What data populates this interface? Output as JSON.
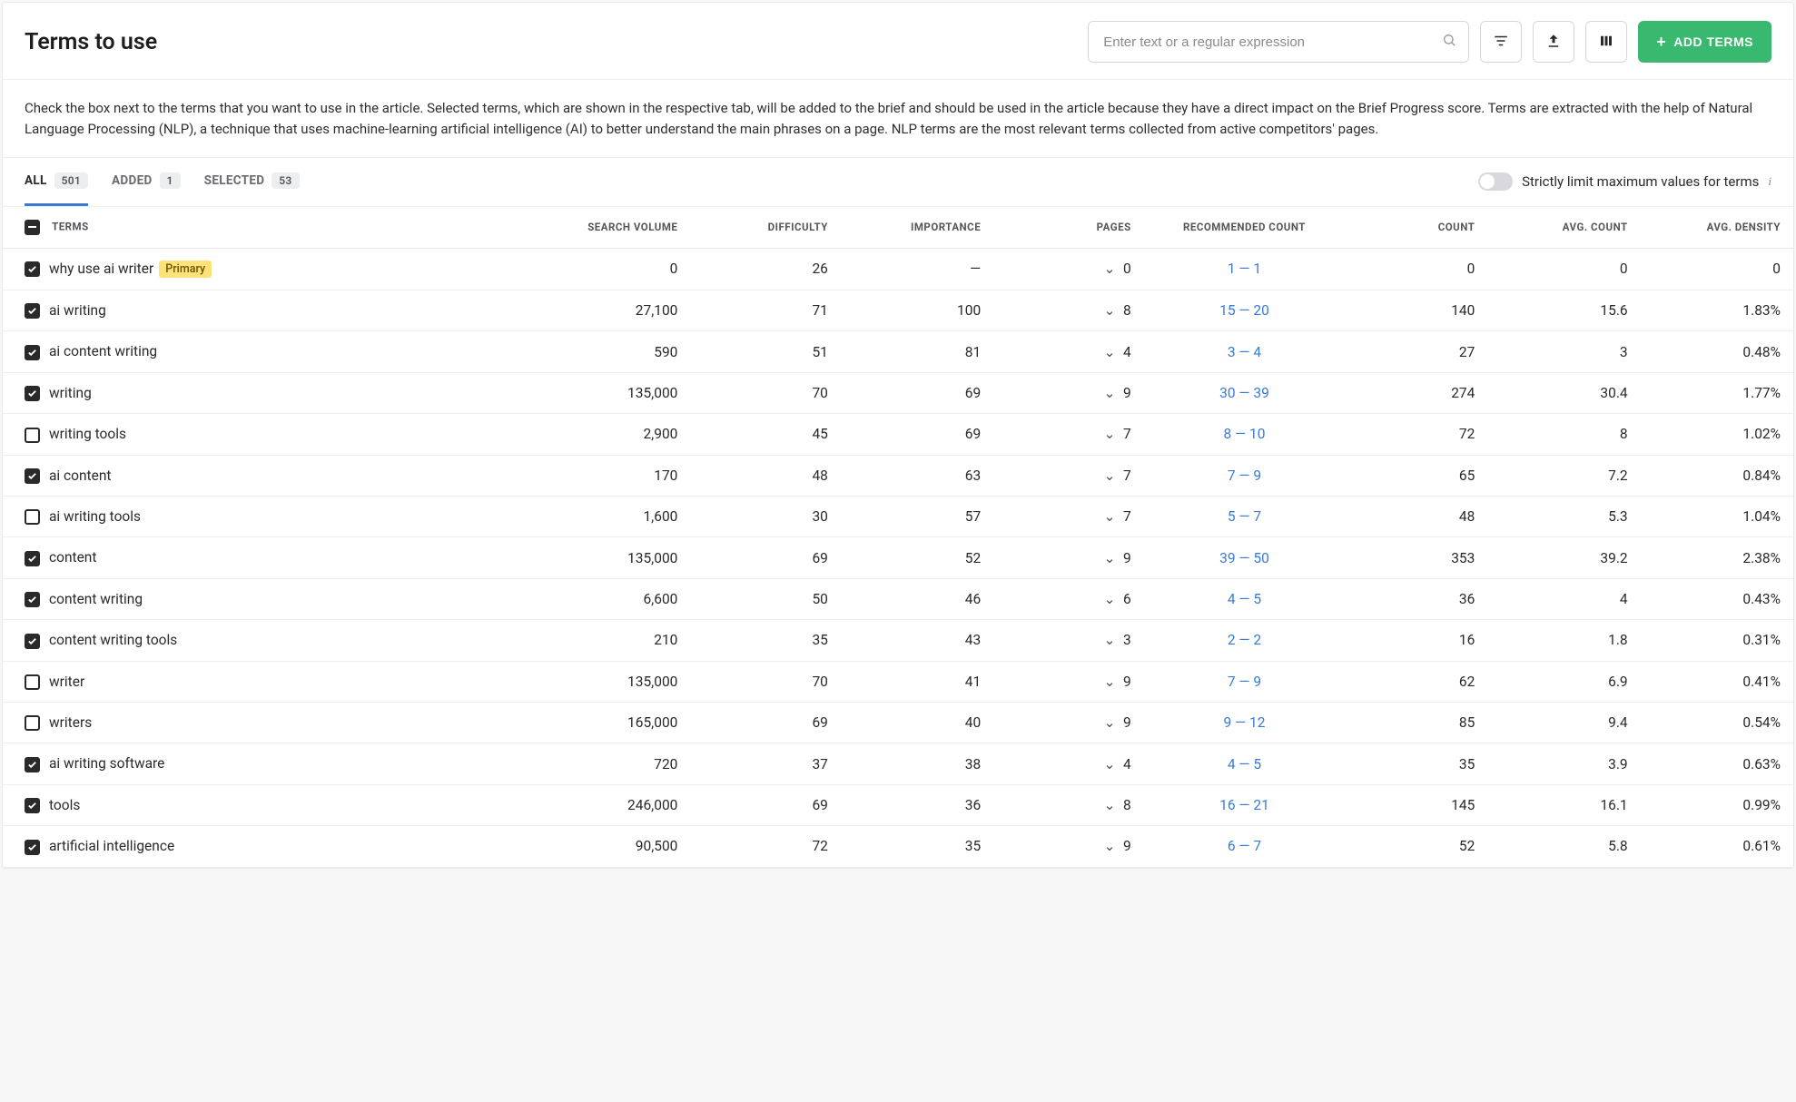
{
  "header": {
    "title": "Terms to use",
    "search_placeholder": "Enter text or a regular expression",
    "add_button": "ADD TERMS"
  },
  "description": "Check the box next to the terms that you want to use in the article. Selected terms, which are shown in the respective tab, will be added to the brief and should be used in the article because they have a direct impact on the Brief Progress score. Terms are extracted with the help of Natural Language Processing (NLP), a technique that uses machine-learning artificial intelligence (AI) to better understand the main phrases on a page. NLP terms are the most relevant terms collected from active competitors' pages.",
  "tabs": {
    "all_label": "ALL",
    "all_count": "501",
    "added_label": "ADDED",
    "added_count": "1",
    "selected_label": "SELECTED",
    "selected_count": "53"
  },
  "toggle_label": "Strictly limit maximum values for terms",
  "columns": {
    "terms": "TERMS",
    "search_volume": "SEARCH VOLUME",
    "difficulty": "DIFFICULTY",
    "importance": "IMPORTANCE",
    "pages": "PAGES",
    "recommended": "RECOMMENDED COUNT",
    "count": "COUNT",
    "avg_count": "AVG. COUNT",
    "avg_density": "AVG. DENSITY"
  },
  "primary_badge": "Primary",
  "rows": [
    {
      "checked": true,
      "term": "why use ai writer",
      "primary": true,
      "sv": "0",
      "diff": "26",
      "imp": "—",
      "pages": "0",
      "rec": "1 — 1",
      "count": "0",
      "avgc": "0",
      "avgd": "0"
    },
    {
      "checked": true,
      "term": "ai writing",
      "primary": false,
      "sv": "27,100",
      "diff": "71",
      "imp": "100",
      "pages": "8",
      "rec": "15 — 20",
      "count": "140",
      "avgc": "15.6",
      "avgd": "1.83%"
    },
    {
      "checked": true,
      "term": "ai content writing",
      "primary": false,
      "sv": "590",
      "diff": "51",
      "imp": "81",
      "pages": "4",
      "rec": "3 — 4",
      "count": "27",
      "avgc": "3",
      "avgd": "0.48%"
    },
    {
      "checked": true,
      "term": "writing",
      "primary": false,
      "sv": "135,000",
      "diff": "70",
      "imp": "69",
      "pages": "9",
      "rec": "30 — 39",
      "count": "274",
      "avgc": "30.4",
      "avgd": "1.77%"
    },
    {
      "checked": false,
      "term": "writing tools",
      "primary": false,
      "sv": "2,900",
      "diff": "45",
      "imp": "69",
      "pages": "7",
      "rec": "8 — 10",
      "count": "72",
      "avgc": "8",
      "avgd": "1.02%"
    },
    {
      "checked": true,
      "term": "ai content",
      "primary": false,
      "sv": "170",
      "diff": "48",
      "imp": "63",
      "pages": "7",
      "rec": "7 — 9",
      "count": "65",
      "avgc": "7.2",
      "avgd": "0.84%"
    },
    {
      "checked": false,
      "term": "ai writing tools",
      "primary": false,
      "sv": "1,600",
      "diff": "30",
      "imp": "57",
      "pages": "7",
      "rec": "5 — 7",
      "count": "48",
      "avgc": "5.3",
      "avgd": "1.04%"
    },
    {
      "checked": true,
      "term": "content",
      "primary": false,
      "sv": "135,000",
      "diff": "69",
      "imp": "52",
      "pages": "9",
      "rec": "39 — 50",
      "count": "353",
      "avgc": "39.2",
      "avgd": "2.38%"
    },
    {
      "checked": true,
      "term": "content writing",
      "primary": false,
      "sv": "6,600",
      "diff": "50",
      "imp": "46",
      "pages": "6",
      "rec": "4 — 5",
      "count": "36",
      "avgc": "4",
      "avgd": "0.43%"
    },
    {
      "checked": true,
      "term": "content writing tools",
      "primary": false,
      "sv": "210",
      "diff": "35",
      "imp": "43",
      "pages": "3",
      "rec": "2 — 2",
      "count": "16",
      "avgc": "1.8",
      "avgd": "0.31%"
    },
    {
      "checked": false,
      "term": "writer",
      "primary": false,
      "sv": "135,000",
      "diff": "70",
      "imp": "41",
      "pages": "9",
      "rec": "7 — 9",
      "count": "62",
      "avgc": "6.9",
      "avgd": "0.41%"
    },
    {
      "checked": false,
      "term": "writers",
      "primary": false,
      "sv": "165,000",
      "diff": "69",
      "imp": "40",
      "pages": "9",
      "rec": "9 — 12",
      "count": "85",
      "avgc": "9.4",
      "avgd": "0.54%"
    },
    {
      "checked": true,
      "term": "ai writing software",
      "primary": false,
      "sv": "720",
      "diff": "37",
      "imp": "38",
      "pages": "4",
      "rec": "4 — 5",
      "count": "35",
      "avgc": "3.9",
      "avgd": "0.63%"
    },
    {
      "checked": true,
      "term": "tools",
      "primary": false,
      "sv": "246,000",
      "diff": "69",
      "imp": "36",
      "pages": "8",
      "rec": "16 — 21",
      "count": "145",
      "avgc": "16.1",
      "avgd": "0.99%"
    },
    {
      "checked": true,
      "term": "artificial intelligence",
      "primary": false,
      "sv": "90,500",
      "diff": "72",
      "imp": "35",
      "pages": "9",
      "rec": "6 — 7",
      "count": "52",
      "avgc": "5.8",
      "avgd": "0.61%"
    }
  ]
}
